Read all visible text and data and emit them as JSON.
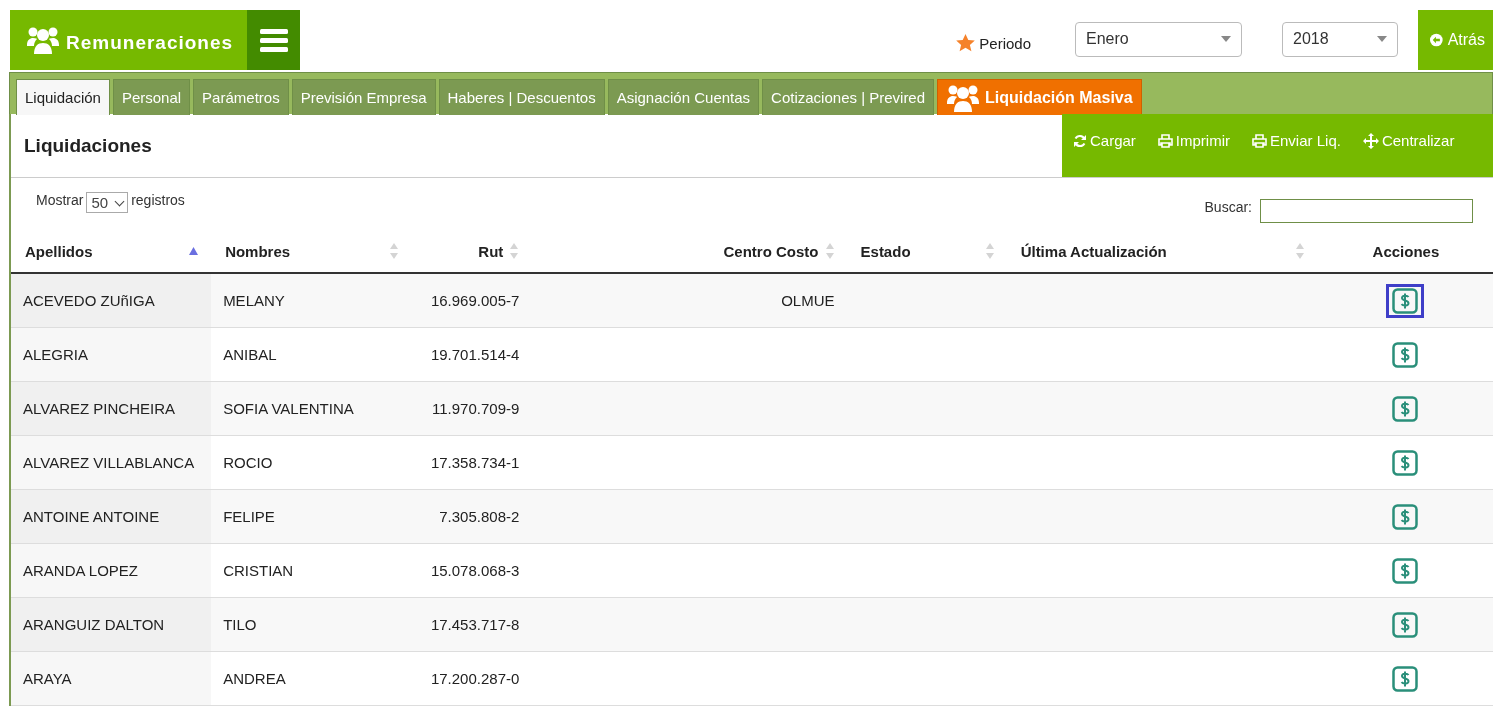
{
  "app": {
    "title": "Remuneraciones"
  },
  "period": {
    "label": "Periodo",
    "month": "Enero",
    "year": "2018"
  },
  "back_button": {
    "label": "Atrás"
  },
  "tabs": [
    {
      "label": "Liquidación",
      "selected": true,
      "kind": "tab"
    },
    {
      "label": "Personal",
      "selected": false,
      "kind": "tab"
    },
    {
      "label": "Parámetros",
      "selected": false,
      "kind": "tab"
    },
    {
      "label": "Previsión Empresa",
      "selected": false,
      "kind": "tab"
    },
    {
      "label": "Haberes | Descuentos",
      "selected": false,
      "kind": "tab"
    },
    {
      "label": "Asignación Cuentas",
      "selected": false,
      "kind": "tab"
    },
    {
      "label": "Cotizaciones | Previred",
      "selected": false,
      "kind": "tab"
    },
    {
      "label": "Liquidación Masiva",
      "selected": false,
      "kind": "highlight"
    }
  ],
  "panel": {
    "title": "Liquidaciones"
  },
  "actions": [
    {
      "label": "Cargar",
      "kind": "refresh"
    },
    {
      "label": "Imprimir",
      "kind": "print"
    },
    {
      "label": "Enviar Liq.",
      "kind": "print"
    },
    {
      "label": "Centralizar",
      "kind": "move"
    }
  ],
  "length": {
    "prefix": "Mostrar",
    "value": "50",
    "suffix": "registros"
  },
  "search": {
    "label": "Buscar:"
  },
  "table": {
    "columns": [
      {
        "label": "Apellidos",
        "sortable": true,
        "sorted": true
      },
      {
        "label": "Nombres",
        "sortable": true,
        "sorted": false
      },
      {
        "label": "Rut",
        "sortable": true,
        "sorted": false
      },
      {
        "label": "Centro Costo",
        "sortable": true,
        "sorted": false
      },
      {
        "label": "Estado",
        "sortable": true,
        "sorted": false
      },
      {
        "label": "Última Actualización",
        "sortable": true,
        "sorted": false
      },
      {
        "label": "Acciones",
        "sortable": false
      }
    ],
    "rows": [
      {
        "apellidos": "ACEVEDO ZUñIGA",
        "nombres": "MELANY",
        "rut": "16.969.005-7",
        "centro_costo": "OLMUE",
        "focused": true
      },
      {
        "apellidos": "ALEGRIA",
        "nombres": "ANIBAL",
        "rut": "19.701.514-4",
        "focused": false
      },
      {
        "apellidos": "ALVAREZ PINCHEIRA",
        "nombres": "SOFIA VALENTINA",
        "rut": "11.970.709-9",
        "focused": false
      },
      {
        "apellidos": "ALVAREZ VILLABLANCA",
        "nombres": "ROCIO",
        "rut": "17.358.734-1",
        "focused": false
      },
      {
        "apellidos": "ANTOINE ANTOINE",
        "nombres": "FELIPE",
        "rut": "7.305.808-2",
        "focused": false
      },
      {
        "apellidos": "ARANDA LOPEZ",
        "nombres": "CRISTIAN",
        "rut": "15.078.068-3",
        "focused": false
      },
      {
        "apellidos": "ARANGUIZ DALTON",
        "nombres": "TILO",
        "rut": "17.453.717-8",
        "focused": false
      },
      {
        "apellidos": "ARAYA",
        "nombres": "ANDREA",
        "rut": "17.200.287-0",
        "focused": false
      }
    ]
  }
}
